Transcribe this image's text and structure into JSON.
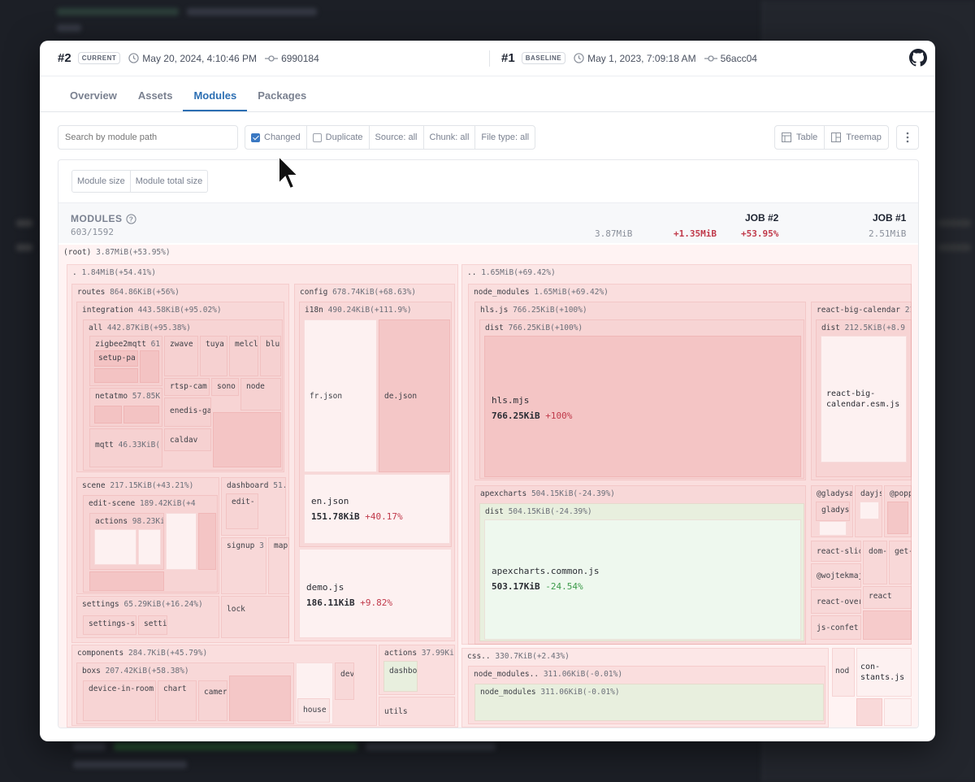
{
  "header": {
    "current": {
      "num": "#2",
      "badge": "CURRENT",
      "date": "May 20, 2024, 4:10:46 PM",
      "commit": "6990184"
    },
    "baseline": {
      "num": "#1",
      "badge": "BASELINE",
      "date": "May 1, 2023, 7:09:18 AM",
      "commit": "56acc04"
    }
  },
  "tabs": [
    "Overview",
    "Assets",
    "Modules",
    "Packages"
  ],
  "active_tab": "Modules",
  "toolbar": {
    "search_placeholder": "Search by module path",
    "changed": "Changed",
    "duplicate": "Duplicate",
    "source": "Source: all",
    "chunk": "Chunk: all",
    "filetype": "File type: all",
    "table": "Table",
    "treemap": "Treemap"
  },
  "size_buttons": [
    "Module size",
    "Module total size"
  ],
  "summary": {
    "title": "MODULES",
    "count": "603/1592",
    "job2_label": "JOB #2",
    "job1_label": "JOB #1",
    "job2_size": "3.87MiB",
    "delta_size": "+1.35MiB",
    "delta_pct": "+53.95%",
    "job1_size": "2.51MiB"
  },
  "treemap": {
    "root": "(root)",
    "root_size": "3.87MiB(+53.95%)",
    "dot": ".",
    "dot_size": "1.84MiB(+54.41%)",
    "dotdot": "..",
    "dotdot_size": "1.65MiB(+69.42%)",
    "routes": "routes",
    "routes_size": "864.86KiB(+56%)",
    "integration": "integration",
    "integration_size": "443.58KiB(+95.02%)",
    "all": "all",
    "all_size": "442.87KiB(+95.38%)",
    "zigbee": "zigbee2mqtt",
    "zigbee_size": "61.",
    "setup": "setup-pa",
    "zwave": "zwave",
    "tuya": "tuya",
    "melcl": "melcl",
    "blu": "blu",
    "rtsp": "rtsp-cam",
    "sono": "sono",
    "node_s": "node",
    "netatmo": "netatmo",
    "netatmo_size": "57.85K",
    "enedis": "enedis-ga",
    "mqtt": "mqtt",
    "mqtt_size": "46.33KiB(",
    "caldav": "caldav",
    "scene": "scene",
    "scene_size": "217.15KiB(+43.21%)",
    "editscene": "edit-scene",
    "editscene_size": "189.42KiB(+4",
    "actions_s": "actions",
    "actions_s_size": "98.23Ki",
    "dashboard": "dashboard",
    "dashboard_size": "51.",
    "edit_s": "edit-",
    "signup": "signup",
    "signup_size": "3",
    "map": "map",
    "settings": "settings",
    "settings_size": "65.29KiB(+16.24%)",
    "settings_s": "settings-s",
    "setti": "setti",
    "lock": "lock",
    "config": "config",
    "config_size": "678.74KiB(+68.63%)",
    "i18n": "i18n",
    "i18n_size": "490.24KiB(+111.9%)",
    "fr": "fr.json",
    "de": "de.json",
    "en": "en.json",
    "en_size": "151.78KiB",
    "en_pct": "+40.17%",
    "demo": "demo.js",
    "demo_size": "186.11KiB",
    "demo_pct": "+9.82%",
    "components": "components",
    "components_size": "284.7KiB(+45.79%)",
    "boxs": "boxs",
    "boxs_size": "207.42KiB(+58.38%)",
    "device": "device-in-room",
    "chart": "chart",
    "camer": "camer",
    "dev": "dev",
    "house": "house",
    "actions_c": "actions",
    "actions_c_size": "37.99Ki",
    "dashbo": "dashbo",
    "utils": "utils",
    "node_modules": "node_modules",
    "node_modules_size": "1.65MiB(+69.42%)",
    "hls": "hls.js",
    "hls_size": "766.25KiB(+100%)",
    "hls_dist": "dist",
    "hls_dist_size": "766.25KiB(+100%)",
    "hls_mjs": "hls.mjs",
    "hls_mjs_size": "766.25KiB",
    "hls_mjs_pct": "+100%",
    "rbc": "react-big-calendar",
    "rbc_size": "21",
    "rbc_dist": "dist",
    "rbc_dist_size": "212.5KiB(+8.9",
    "rbc_file": "react-big-\ncalendar.esm.js",
    "apex": "apexcharts",
    "apex_size": "504.15KiB(-24.39%)",
    "apex_dist": "dist",
    "apex_dist_size": "504.15KiB(-24.39%)",
    "apex_file": "apexcharts.common.js",
    "apex_file_size": "503.17KiB",
    "apex_file_pct": "-24.54%",
    "gladysa": "@gladysa",
    "gladys": "gladys",
    "dayjs": "dayjs",
    "popp": "@popp",
    "react_sli": "react-slic",
    "dom": "dom-",
    "get": "get-",
    "wojtek": "@wojtekmaj",
    "react_s": "react",
    "react_over": "react-over",
    "js_confet": "js-confet",
    "css": "css..",
    "css_size": "330.7KiB(+2.43%)",
    "nm2": "node_modules..",
    "nm2_size": "311.06KiB(-0.01%)",
    "nm3": "node_modules",
    "nm3_size": "311.06KiB(-0.01%)",
    "nod": "nod",
    "constants": "con-\nstants.js"
  },
  "colors": {
    "accent": "#2c6fb3",
    "increase": "#c0394a",
    "decrease": "#3c9a4a"
  }
}
